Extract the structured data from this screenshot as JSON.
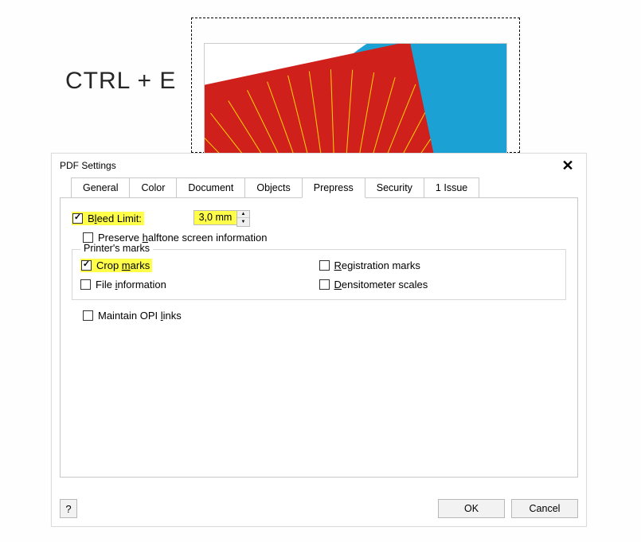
{
  "hint": "CTRL + E",
  "dialog": {
    "title": "PDF Settings",
    "tabs": {
      "general": "General",
      "color": "Color",
      "document": "Document",
      "objects": "Objects",
      "prepress": "Prepress",
      "security": "Security",
      "issues": "1 Issue"
    },
    "prepress": {
      "bleed_limit_label_pre": "B",
      "bleed_limit_label_u": "l",
      "bleed_limit_label_post": "eed Limit:",
      "bleed_value": "3,0 mm",
      "preserve_halftone_pre": "Preserve ",
      "preserve_halftone_u": "h",
      "preserve_halftone_post": "alftone screen information",
      "printers_marks_legend": "Printer's marks",
      "crop_marks_pre": "Crop ",
      "crop_marks_u": "m",
      "crop_marks_post": "arks",
      "file_info_pre": "File ",
      "file_info_u": "i",
      "file_info_post": "nformation",
      "registration_pre": "",
      "registration_u": "R",
      "registration_post": "egistration marks",
      "densitometer_pre": "",
      "densitometer_u": "D",
      "densitometer_post": "ensitometer scales",
      "maintain_opi_pre": "Maintain OPI ",
      "maintain_opi_u": "l",
      "maintain_opi_post": "inks"
    },
    "buttons": {
      "help": "?",
      "ok": "OK",
      "cancel": "Cancel"
    }
  }
}
